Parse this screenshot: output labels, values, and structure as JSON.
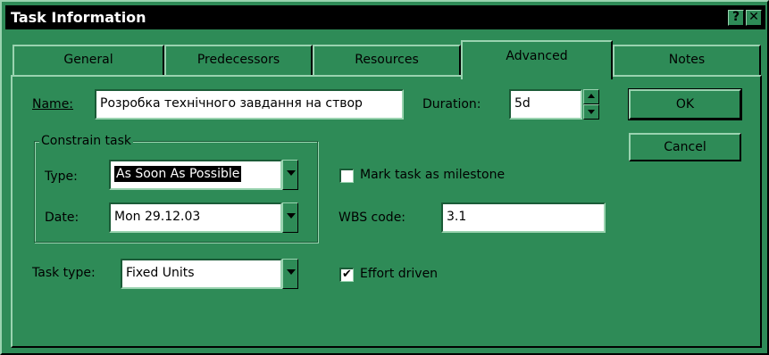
{
  "window": {
    "title": "Task Information",
    "help_glyph": "?",
    "close_glyph": "✕"
  },
  "tabs": [
    {
      "label": "General",
      "active": false
    },
    {
      "label": "Predecessors",
      "active": false
    },
    {
      "label": "Resources",
      "active": false
    },
    {
      "label": "Advanced",
      "active": true
    },
    {
      "label": "Notes",
      "active": false
    }
  ],
  "name": {
    "label": "Name:",
    "value": "Розробка технічного завдання на створ"
  },
  "duration": {
    "label": "Duration:",
    "value": "5d"
  },
  "constrain": {
    "legend": "Constrain task",
    "type_label": "Type:",
    "type_value": "As Soon As Possible",
    "date_label": "Date:",
    "date_value": "Mon 29.12.03"
  },
  "milestone": {
    "label": "Mark task as milestone",
    "checked": false
  },
  "wbs": {
    "label": "WBS code:",
    "value": "3.1"
  },
  "task_type": {
    "label": "Task type:",
    "value": "Fixed Units"
  },
  "effort": {
    "label": "Effort driven",
    "checked": true,
    "check_glyph": "✔"
  },
  "buttons": {
    "ok": "OK",
    "cancel": "Cancel"
  }
}
